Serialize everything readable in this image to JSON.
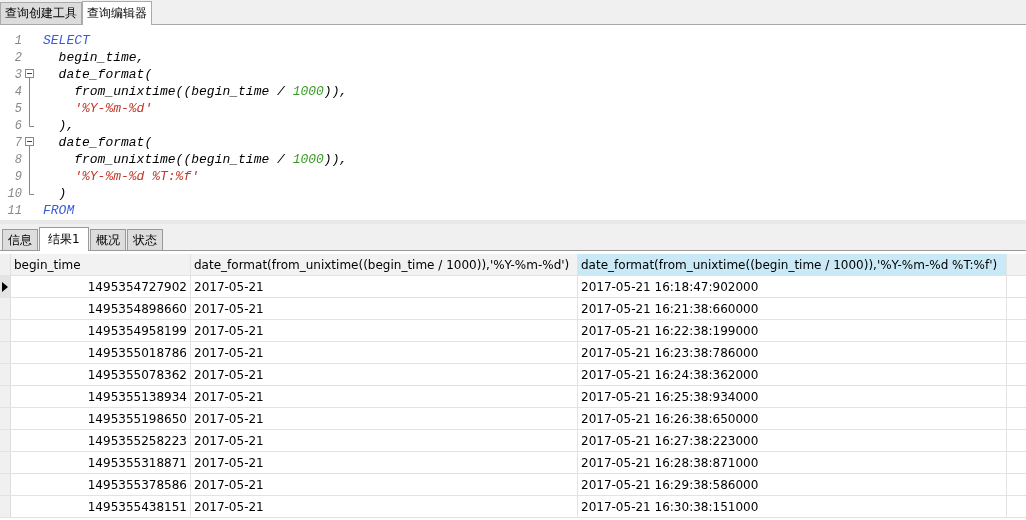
{
  "editor_tabs": [
    {
      "label": "查询创建工具",
      "selected": false
    },
    {
      "label": "查询编辑器",
      "selected": true
    }
  ],
  "code_lines": [
    {
      "number": "1",
      "kind": "plain",
      "tokens": [
        {
          "kind": "keyword",
          "text": "SELECT"
        }
      ]
    },
    {
      "number": "2",
      "kind": "plain",
      "tokens": [
        {
          "kind": "ident",
          "text": "  begin_time,"
        }
      ]
    },
    {
      "number": "3",
      "kind": "fold_start",
      "tokens": [
        {
          "kind": "ident",
          "text": "  date_format("
        }
      ]
    },
    {
      "number": "4",
      "kind": "fold_inner",
      "tokens": [
        {
          "kind": "ident",
          "text": "    from_unixtime((begin_time / "
        },
        {
          "kind": "number",
          "text": "1000"
        },
        {
          "kind": "ident",
          "text": ")),"
        }
      ]
    },
    {
      "number": "5",
      "kind": "fold_inner",
      "tokens": [
        {
          "kind": "string",
          "text": "    '%Y-%m-%d'"
        }
      ]
    },
    {
      "number": "6",
      "kind": "fold_end",
      "tokens": [
        {
          "kind": "ident",
          "text": "  ),"
        }
      ]
    },
    {
      "number": "7",
      "kind": "fold_start",
      "tokens": [
        {
          "kind": "ident",
          "text": "  date_format("
        }
      ]
    },
    {
      "number": "8",
      "kind": "fold_inner",
      "tokens": [
        {
          "kind": "ident",
          "text": "    from_unixtime((begin_time / "
        },
        {
          "kind": "number",
          "text": "1000"
        },
        {
          "kind": "ident",
          "text": ")),"
        }
      ]
    },
    {
      "number": "9",
      "kind": "fold_inner",
      "tokens": [
        {
          "kind": "string",
          "text": "    '%Y-%m-%d %T:%f'"
        }
      ]
    },
    {
      "number": "10",
      "kind": "fold_end",
      "tokens": [
        {
          "kind": "ident",
          "text": "  )"
        }
      ]
    },
    {
      "number": "11",
      "kind": "plain",
      "tokens": [
        {
          "kind": "keyword",
          "text": "FROM"
        }
      ]
    }
  ],
  "result_tabs": [
    {
      "label": "信息",
      "selected": false
    },
    {
      "label": "结果1",
      "selected": true
    },
    {
      "label": "概况",
      "selected": false
    },
    {
      "label": "状态",
      "selected": false
    }
  ],
  "table": {
    "columns": [
      {
        "label": "begin_time",
        "selected": false
      },
      {
        "label": "date_format(from_unixtime((begin_time / 1000)),'%Y-%m-%d')",
        "selected": false
      },
      {
        "label": "date_format(from_unixtime((begin_time / 1000)),'%Y-%m-%d %T:%f')",
        "selected": true
      }
    ],
    "rows": [
      {
        "selected": true,
        "cells": [
          "1495354727902",
          "2017-05-21",
          "2017-05-21 16:18:47:902000"
        ]
      },
      {
        "selected": false,
        "cells": [
          "1495354898660",
          "2017-05-21",
          "2017-05-21 16:21:38:660000"
        ]
      },
      {
        "selected": false,
        "cells": [
          "1495354958199",
          "2017-05-21",
          "2017-05-21 16:22:38:199000"
        ]
      },
      {
        "selected": false,
        "cells": [
          "1495355018786",
          "2017-05-21",
          "2017-05-21 16:23:38:786000"
        ]
      },
      {
        "selected": false,
        "cells": [
          "1495355078362",
          "2017-05-21",
          "2017-05-21 16:24:38:362000"
        ]
      },
      {
        "selected": false,
        "cells": [
          "1495355138934",
          "2017-05-21",
          "2017-05-21 16:25:38:934000"
        ]
      },
      {
        "selected": false,
        "cells": [
          "1495355198650",
          "2017-05-21",
          "2017-05-21 16:26:38:650000"
        ]
      },
      {
        "selected": false,
        "cells": [
          "1495355258223",
          "2017-05-21",
          "2017-05-21 16:27:38:223000"
        ]
      },
      {
        "selected": false,
        "cells": [
          "1495355318871",
          "2017-05-21",
          "2017-05-21 16:28:38:871000"
        ]
      },
      {
        "selected": false,
        "cells": [
          "1495355378586",
          "2017-05-21",
          "2017-05-21 16:29:38:586000"
        ]
      },
      {
        "selected": false,
        "cells": [
          "1495355438151",
          "2017-05-21",
          "2017-05-21 16:30:38:151000"
        ]
      }
    ]
  }
}
